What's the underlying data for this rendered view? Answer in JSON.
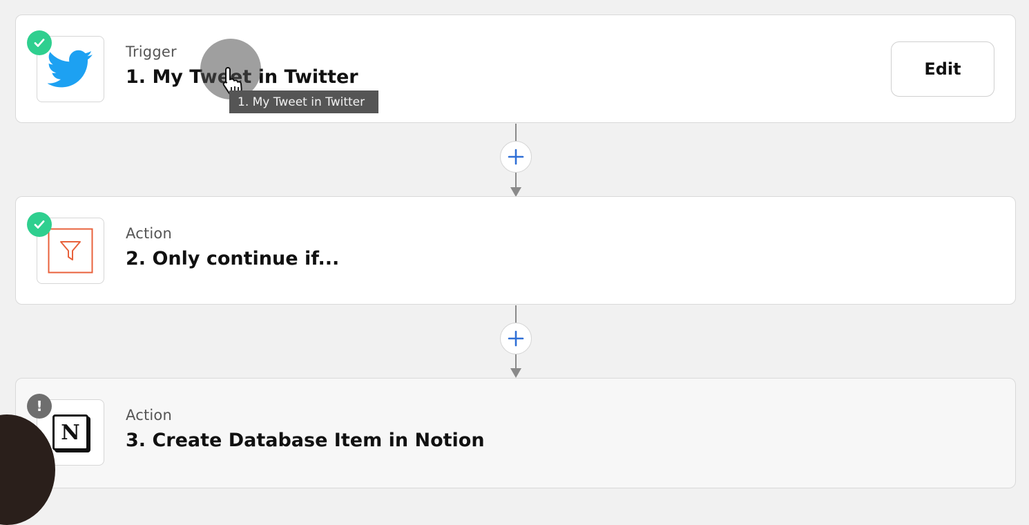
{
  "steps": [
    {
      "type": "Trigger",
      "title": "1. My Tweet in Twitter",
      "app": "twitter-icon",
      "status": "complete"
    },
    {
      "type": "Action",
      "title": "2. Only continue if...",
      "app": "filter-icon",
      "status": "complete"
    },
    {
      "type": "Action",
      "title": "3. Create Database Item in Notion",
      "app": "notion-icon",
      "status": "warning"
    }
  ],
  "edit_label": "Edit",
  "tooltip_text": "1.  My Tweet in Twitter",
  "warning_glyph": "!",
  "notion_glyph": "N",
  "colors": {
    "success": "#2fcf8f",
    "warning": "#6e6e6e",
    "twitter": "#1da1f2",
    "filter": "#e8613b",
    "add_plus": "#2f6fd6"
  }
}
